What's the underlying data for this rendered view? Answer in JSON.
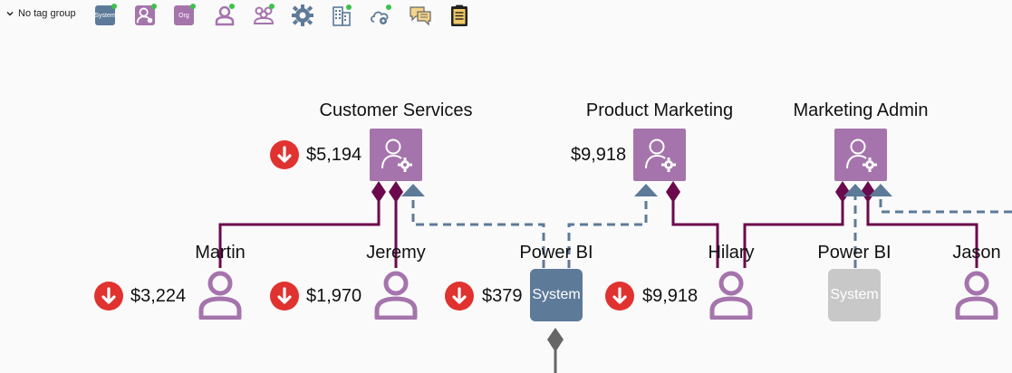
{
  "toolbar": {
    "tag_group_label": "No tag group",
    "icons": [
      {
        "name": "system-tag-icon",
        "text": "System"
      },
      {
        "name": "person-tag-icon"
      },
      {
        "name": "org-tag-icon",
        "text": "Org"
      },
      {
        "name": "person-icon"
      },
      {
        "name": "group-icon"
      },
      {
        "name": "gear-icon"
      },
      {
        "name": "building-icon"
      },
      {
        "name": "cloud-gear-icon"
      },
      {
        "name": "comments-icon"
      },
      {
        "name": "clipboard-icon"
      }
    ]
  },
  "colors": {
    "role": "#a574ac",
    "person": "#a574ac",
    "system": "#5d7a99",
    "system_faded": "#c8c8c8",
    "link_solid": "#6b0a4c",
    "link_dashed": "#5d7a99",
    "badge": "#e0322f",
    "connector": "#666666"
  },
  "roles": [
    {
      "label": "Customer Services",
      "value": "$5,194"
    },
    {
      "label": "Product Marketing",
      "value": "$9,918"
    },
    {
      "label": "Marketing Admin"
    }
  ],
  "people": [
    {
      "label": "Martin",
      "value": "$3,224"
    },
    {
      "label": "Jeremy",
      "value": "$1,970"
    },
    {
      "label": "Hilary",
      "value": "$9,918"
    },
    {
      "label": "Jason"
    }
  ],
  "systems": [
    {
      "label": "Power BI",
      "value": "$379",
      "box_text": "System"
    },
    {
      "label": "Power BI",
      "box_text": "System"
    }
  ]
}
